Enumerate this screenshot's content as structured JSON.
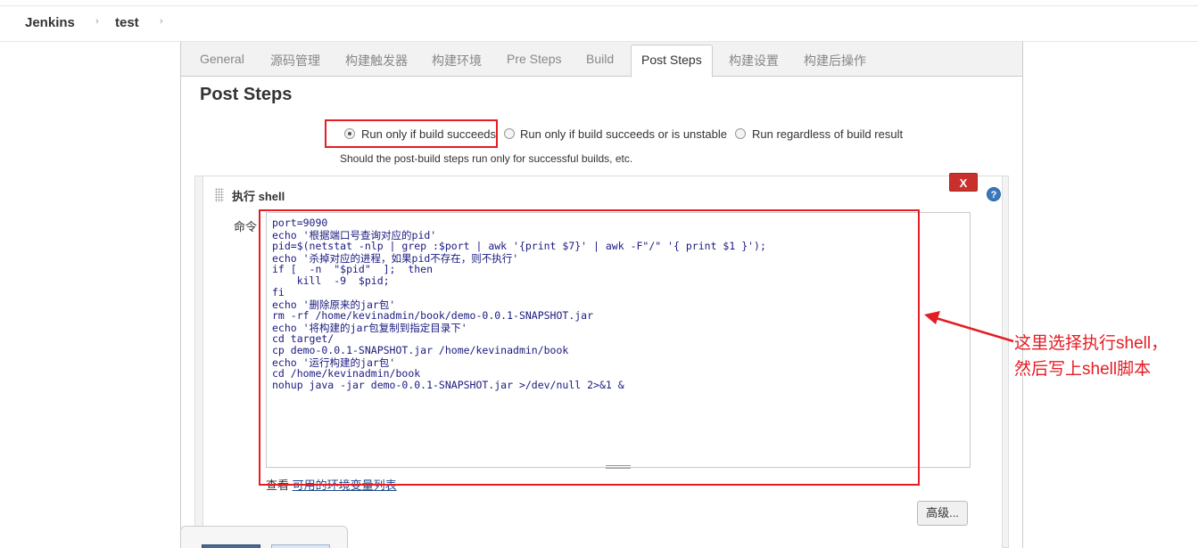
{
  "breadcrumb": {
    "items": [
      "Jenkins",
      "test"
    ],
    "separator": "›"
  },
  "tabs": {
    "items": [
      "General",
      "源码管理",
      "构建触发器",
      "构建环境",
      "Pre Steps",
      "Build",
      "Post Steps",
      "构建设置",
      "构建后操作"
    ],
    "active": "Post Steps"
  },
  "post_steps": {
    "title": "Post Steps",
    "options": [
      {
        "label": "Run only if build succeeds",
        "checked": true
      },
      {
        "label": "Run only if build succeeds or is unstable",
        "checked": false
      },
      {
        "label": "Run regardless of build result",
        "checked": false
      }
    ],
    "hint": "Should the post-build steps run only for successful builds, etc."
  },
  "shell_step": {
    "title": "执行 shell",
    "delete_label": "X",
    "help_label": "?",
    "command_label": "命令",
    "script_lines": [
      "port=9090",
      "echo '根据端口号查询对应的pid'",
      "pid=$(netstat -nlp | grep :$port | awk '{print $7}' | awk -F\"/\" '{ print $1 }');",
      "echo '杀掉对应的进程，如果pid不存在，则不执行'",
      "if [  -n  \"$pid\"  ];  then",
      "    kill  -9  $pid;",
      "fi",
      "echo '删除原来的jar包'",
      "rm -rf /home/kevinadmin/book/demo-0.0.1-SNAPSHOT.jar",
      "echo '将构建的jar包复制到指定目录下'",
      "cd target/",
      "cp demo-0.0.1-SNAPSHOT.jar /home/kevinadmin/book",
      "echo '运行构建的jar包'",
      "cd /home/kevinadmin/book",
      "nohup java -jar demo-0.0.1-SNAPSHOT.jar >/dev/null 2>&1 &"
    ],
    "env_prefix": "查看 ",
    "env_link": "可用的环境变量列表",
    "advanced_label": "高级..."
  },
  "annotation": {
    "text_line1": "这里选择执行shell，",
    "text_line2": "然后写上shell脚本"
  },
  "colors": {
    "highlight": "#e51c23",
    "delete": "#c9302c",
    "help": "#3a77bd"
  },
  "icons": [
    "chevron-right-icon",
    "radio-icon",
    "drag-handle-icon",
    "help-icon",
    "arrow-icon"
  ]
}
